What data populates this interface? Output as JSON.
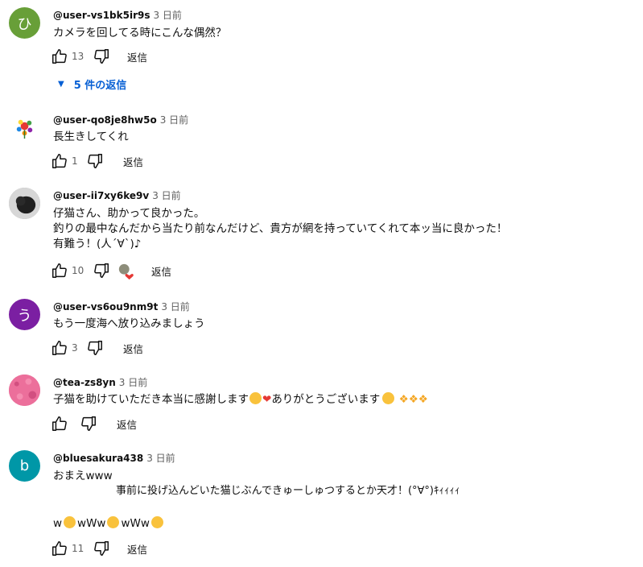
{
  "ui": {
    "reply_label": "返信"
  },
  "comments": [
    {
      "author": "@user-vs1bk5ir9s",
      "time": "3 日前",
      "avatar_letter": "ひ",
      "avatar_color": "#689f38",
      "lines": [
        "カメラを回してる時にこんな偶然？"
      ],
      "likes": "13",
      "replies_label": "5 件の返信"
    },
    {
      "author": "@user-qo8je8hw5o",
      "time": "3 日前",
      "lines": [
        "長生きしてくれ"
      ],
      "likes": "1"
    },
    {
      "author": "@user-ii7xy6ke9v",
      "time": "3 日前",
      "lines": [
        "仔猫さん、助かって良かった。",
        "釣りの最中なんだから当たり前なんだけど、貴方が網を持っていてくれて本ッ当に良かった！",
        "有難う！(人´∀`)♪"
      ],
      "likes": "10"
    },
    {
      "author": "@user-vs6ou9nm9t",
      "time": "3 日前",
      "avatar_letter": "う",
      "avatar_color": "#7b1fa2",
      "lines": [
        "もう一度海へ放り込みましょう"
      ],
      "likes": "3"
    },
    {
      "author": "@tea-zs8yn",
      "time": "3 日前",
      "line_before_emoji": "子猫を助けていただき本当に感謝します",
      "line_mid": "ありがとうございます",
      "likes": ""
    },
    {
      "author": "@bluesakura438",
      "time": "3 日前",
      "avatar_letter": "b",
      "avatar_color": "#0097a7",
      "lines": [
        "おまえwww",
        "　　　　　　事前に投げ込んどいた猫じぶんできゅーしゅつするとか天才！(°∀°)ｷｨｨｨｨ"
      ],
      "last_parts": [
        "w",
        "wWw",
        "wWw"
      ],
      "likes": "11"
    }
  ]
}
